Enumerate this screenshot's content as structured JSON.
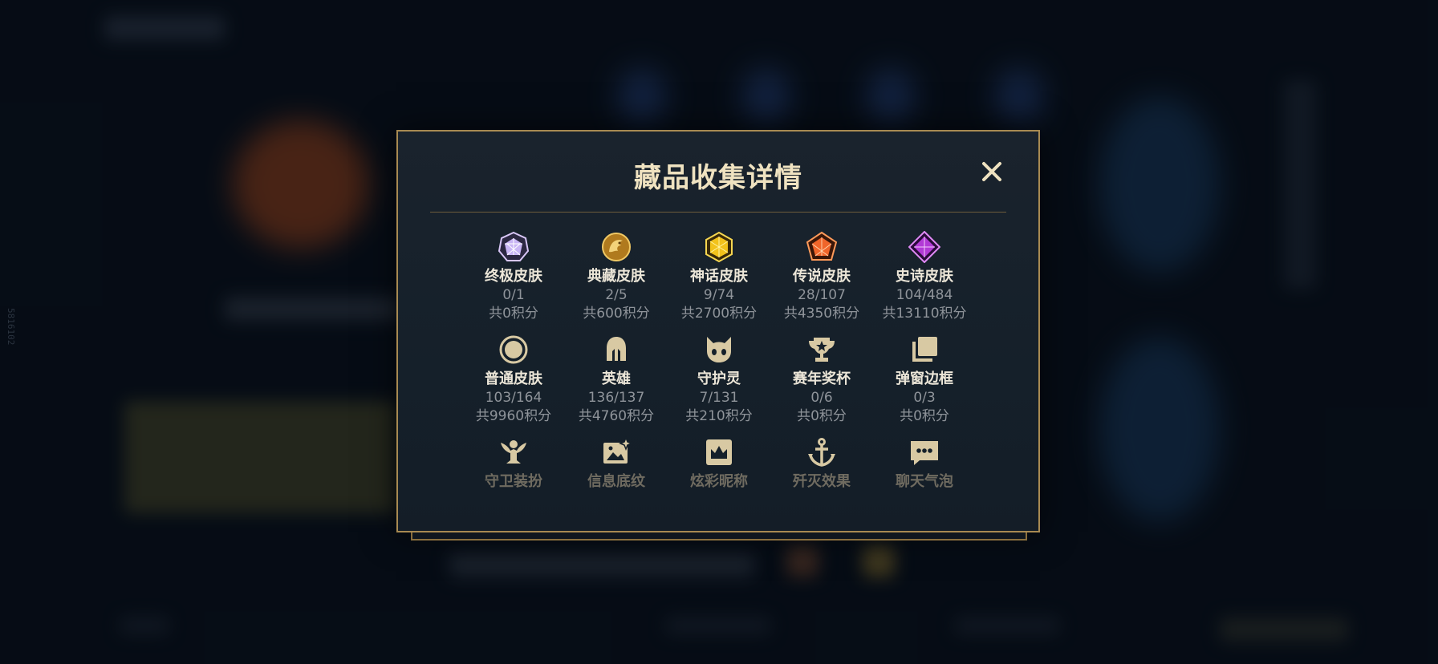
{
  "side_id": "5816102",
  "modal": {
    "title": "藏品收集详情"
  },
  "categories": [
    {
      "name": "终极皮肤",
      "count": "0/1",
      "points": "共0积分",
      "icon": "ultimate-gem-icon",
      "color": "#c9b6f5"
    },
    {
      "name": "典藏皮肤",
      "count": "2/5",
      "points": "共600积分",
      "icon": "dragon-emblem-icon",
      "color": "#e0a83a"
    },
    {
      "name": "神话皮肤",
      "count": "9/74",
      "points": "共2700积分",
      "icon": "mythic-gem-icon",
      "color": "#f2c21b"
    },
    {
      "name": "传说皮肤",
      "count": "28/107",
      "points": "共4350积分",
      "icon": "legendary-gem-icon",
      "color": "#f0652a"
    },
    {
      "name": "史诗皮肤",
      "count": "104/484",
      "points": "共13110积分",
      "icon": "epic-gem-icon",
      "color": "#b23ad6"
    },
    {
      "name": "普通皮肤",
      "count": "103/164",
      "points": "共9960积分",
      "icon": "circle-icon",
      "color": "#d8c9a3"
    },
    {
      "name": "英雄",
      "count": "136/137",
      "points": "共4760积分",
      "icon": "helmet-icon",
      "color": "#d8c9a3"
    },
    {
      "name": "守护灵",
      "count": "7/131",
      "points": "共210积分",
      "icon": "guardian-spirit-icon",
      "color": "#d8c9a3"
    },
    {
      "name": "赛年奖杯",
      "count": "0/6",
      "points": "共0积分",
      "icon": "trophy-icon",
      "color": "#d8c9a3"
    },
    {
      "name": "弹窗边框",
      "count": "0/3",
      "points": "共0积分",
      "icon": "frame-cards-icon",
      "color": "#d8c9a3"
    },
    {
      "name": "守卫装扮",
      "icon": "ward-icon",
      "color": "#d8c9a3"
    },
    {
      "name": "信息底纹",
      "icon": "image-sparkle-icon",
      "color": "#d8c9a3"
    },
    {
      "name": "炫彩昵称",
      "icon": "crown-badge-icon",
      "color": "#d8c9a3"
    },
    {
      "name": "歼灭效果",
      "icon": "anchor-icon",
      "color": "#d8c9a3"
    },
    {
      "name": "聊天气泡",
      "icon": "chat-bubble-icon",
      "color": "#d8c9a3"
    }
  ]
}
